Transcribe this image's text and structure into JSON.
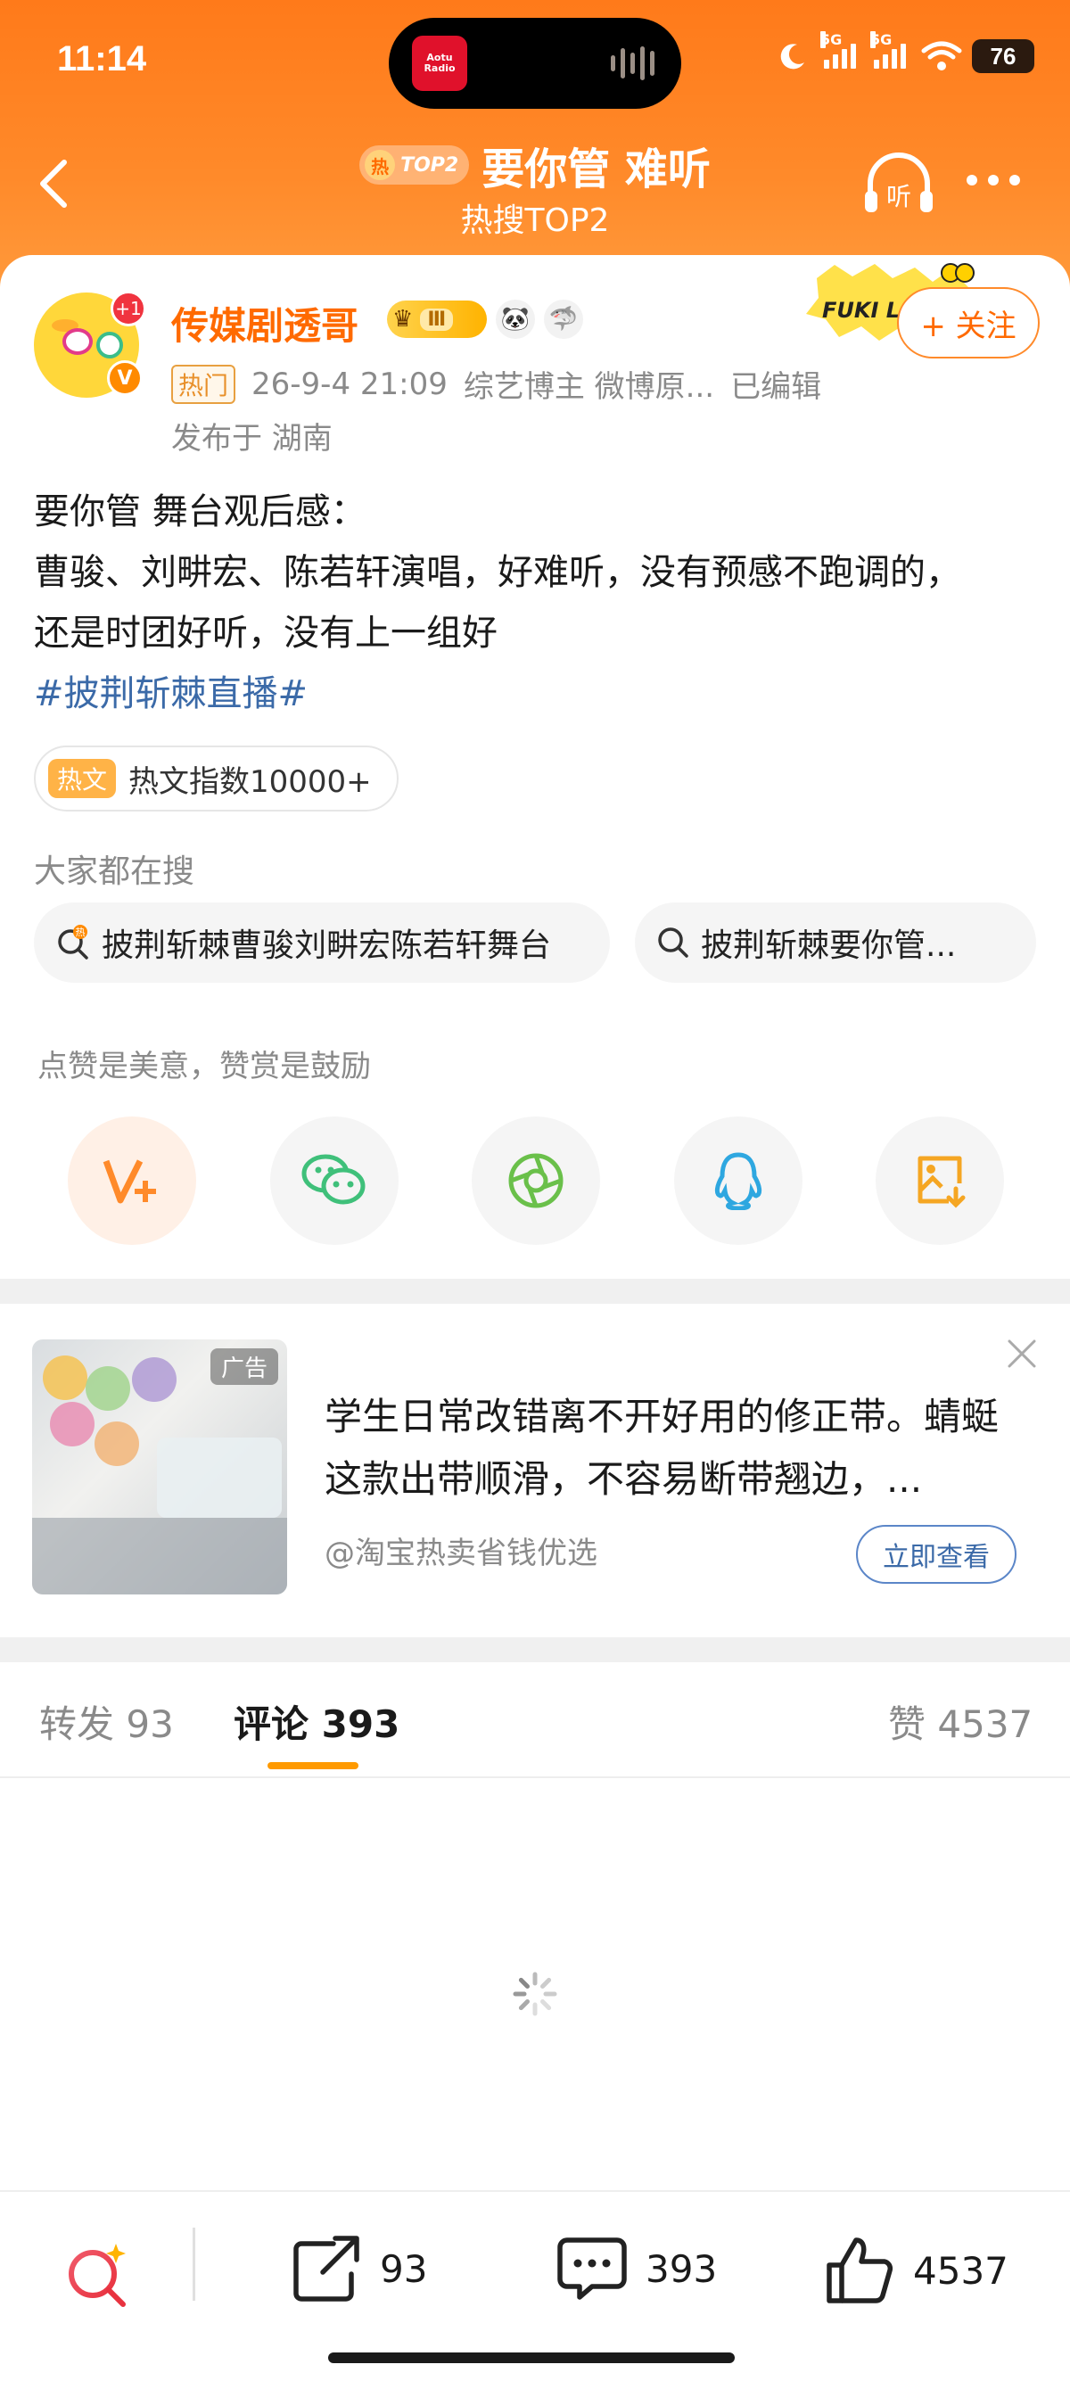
{
  "status_bar": {
    "time": "11:14",
    "island_app": "Aotu Radio",
    "battery": "76",
    "signal_label": "5G"
  },
  "nav": {
    "badge_hot": "热",
    "badge_rank": "TOP2",
    "title": "要你管 难听",
    "subtitle": "热搜TOP2",
    "listen_label": "听"
  },
  "post": {
    "author": "传媒剧透哥",
    "avatar_badge": "+1",
    "verified": "V",
    "vip_level": "Ⅲ",
    "hot_tag": "热门",
    "datetime": "26-9-4 21:09",
    "category": "综艺博主 微博原...",
    "edited": "已编辑",
    "location": "发布于 湖南",
    "follow_label": "+ 关注",
    "sticker_text": "FUKI L.A",
    "text_line1": "要你管 舞台观后感：",
    "text_line2": "曹骏、刘畊宏、陈若轩演唱，好难听，没有预感不跑调的，",
    "text_line3": "还是时团好听，没有上一组好",
    "hashtag": "#披荆斩棘直播#",
    "hot_index_tag": "热文",
    "hot_index_text": "热文指数10000+"
  },
  "search": {
    "title": "大家都在搜",
    "chips": [
      {
        "label": "披荆斩棘曹骏刘畊宏陈若轩舞台",
        "hot_mark": "热"
      },
      {
        "label": "披荆斩棘要你管..."
      }
    ]
  },
  "share": {
    "praise_text": "点赞是美意，赞赏是鼓励",
    "buttons": [
      {
        "name": "reward",
        "icon": "v-plus-icon",
        "color": "#ff8a2a"
      },
      {
        "name": "wechat",
        "icon": "wechat-icon",
        "color": "#3fc07a"
      },
      {
        "name": "moments",
        "icon": "moments-icon",
        "color": "#6ac04a"
      },
      {
        "name": "qq",
        "icon": "qq-icon",
        "color": "#2ea7e0"
      },
      {
        "name": "save-image",
        "icon": "save-image-icon",
        "color": "#f5a623"
      }
    ]
  },
  "ad": {
    "label": "广告",
    "text": "学生日常改错离不开好用的修正带。蜻蜓这款出带顺滑，不容易断带翘边，...",
    "source": "@淘宝热卖省钱优选",
    "button": "立即查看"
  },
  "tabs": {
    "repost_label": "转发",
    "repost_count": "93",
    "comment_label": "评论",
    "comment_count": "393",
    "like_label": "赞",
    "like_count": "4537"
  },
  "bottom_bar": {
    "repost_count": "93",
    "comment_count": "393",
    "like_count": "4537"
  },
  "colors": {
    "brand_orange": "#ff7a1a",
    "link_blue": "#3b6aa8",
    "tab_underline": "#ff9a00"
  }
}
